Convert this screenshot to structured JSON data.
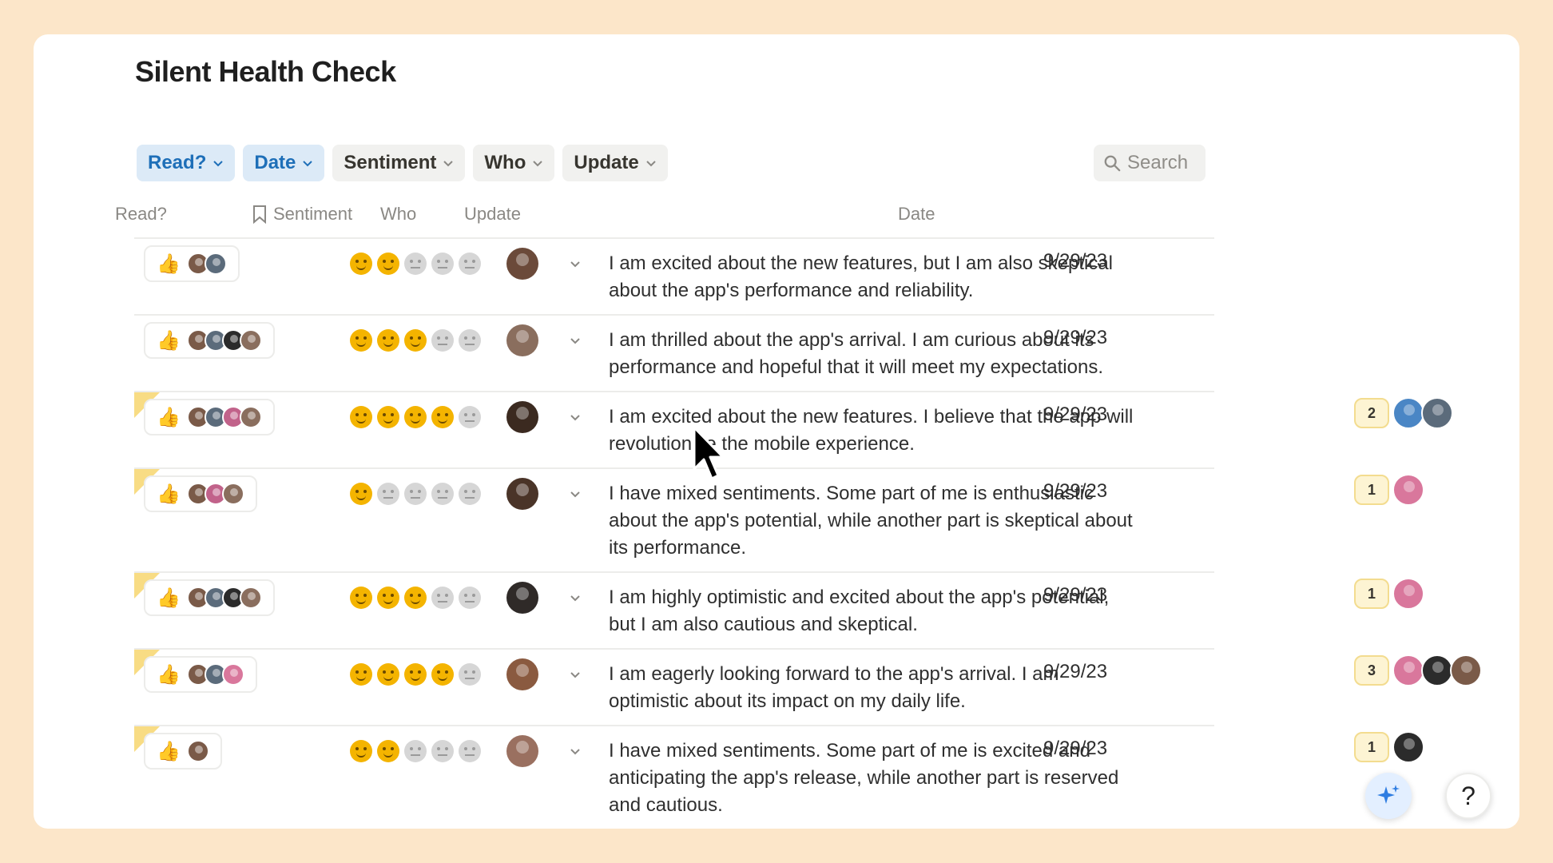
{
  "page": {
    "title": "Silent Health Check"
  },
  "filters": [
    {
      "label": "Read?",
      "active": true
    },
    {
      "label": "Date",
      "active": true
    },
    {
      "label": "Sentiment",
      "active": false
    },
    {
      "label": "Who",
      "active": false
    },
    {
      "label": "Update",
      "active": false
    }
  ],
  "search": {
    "label": "Search"
  },
  "columns": {
    "read": "Read?",
    "sentiment": "Sentiment",
    "who": "Who",
    "update": "Update",
    "date": "Date"
  },
  "colors": {
    "accent": "#1e6fb8",
    "sentiment_on": "#f4b400",
    "sentiment_off": "#d6d6d6",
    "comment_bubble": "#fdf4d3"
  },
  "rows": [
    {
      "flag": false,
      "readers": [
        "#7a5a48",
        "#5b6b7b"
      ],
      "sentiment": 2,
      "who": "#6b4a3a",
      "update": "I am excited about the new features, but I am also skeptical about the app's performance and reliability.",
      "date": "9/29/23",
      "comments": null
    },
    {
      "flag": false,
      "readers": [
        "#7a5a48",
        "#5b6b7b",
        "#2b2b2b",
        "#8a6e5e"
      ],
      "sentiment": 3,
      "who": "#8a6e5e",
      "update": "I am thrilled about the app's arrival. I am curious about its performance and hopeful that it will meet my expectations.",
      "date": "9/29/23",
      "comments": null
    },
    {
      "flag": true,
      "readers": [
        "#7a5a48",
        "#5b6b7b",
        "#c1628a",
        "#8a6e5e"
      ],
      "sentiment": 4,
      "who": "#3b2a20",
      "update": "I am excited about the new features. I believe that the app will revolutionize the mobile experience.",
      "date": "9/29/23",
      "comments": {
        "count": "2",
        "avatars": [
          "#4a86c5",
          "#5b6b7b"
        ]
      }
    },
    {
      "flag": true,
      "readers": [
        "#7a5a48",
        "#c1628a",
        "#8a6e5e"
      ],
      "sentiment": 1,
      "who": "#4a3428",
      "update": "I have mixed sentiments. Some part of me is enthusiastic about the app's potential, while another part is skeptical about its performance.",
      "date": "9/29/23",
      "comments": {
        "count": "1",
        "avatars": [
          "#d9779c"
        ]
      }
    },
    {
      "flag": true,
      "readers": [
        "#7a5a48",
        "#5b6b7b",
        "#2b2b2b",
        "#8a6e5e"
      ],
      "sentiment": 3,
      "who": "#2f2a28",
      "update": "I am highly optimistic and excited about the app's potential, but I am also cautious and skeptical.",
      "date": "9/29/23",
      "comments": {
        "count": "1",
        "avatars": [
          "#d9779c"
        ]
      }
    },
    {
      "flag": true,
      "readers": [
        "#7a5a48",
        "#5b6b7b",
        "#d9779c"
      ],
      "sentiment": 4,
      "who": "#8a5a40",
      "update": "I am eagerly looking forward to the app's arrival. I am optimistic about its impact on my daily life.",
      "date": "9/29/23",
      "comments": {
        "count": "3",
        "avatars": [
          "#d9779c",
          "#2b2b2b",
          "#7a5a48"
        ]
      }
    },
    {
      "flag": true,
      "readers": [
        "#7a5a48"
      ],
      "sentiment": 2,
      "who": "#9a7060",
      "update": "I have mixed sentiments. Some part of me is excited and anticipating the app's release, while another part is reserved and cautious.",
      "date": "9/29/23",
      "comments": {
        "count": "1",
        "avatars": [
          "#2b2b2b"
        ]
      }
    }
  ],
  "fab": {
    "help_label": "?"
  }
}
